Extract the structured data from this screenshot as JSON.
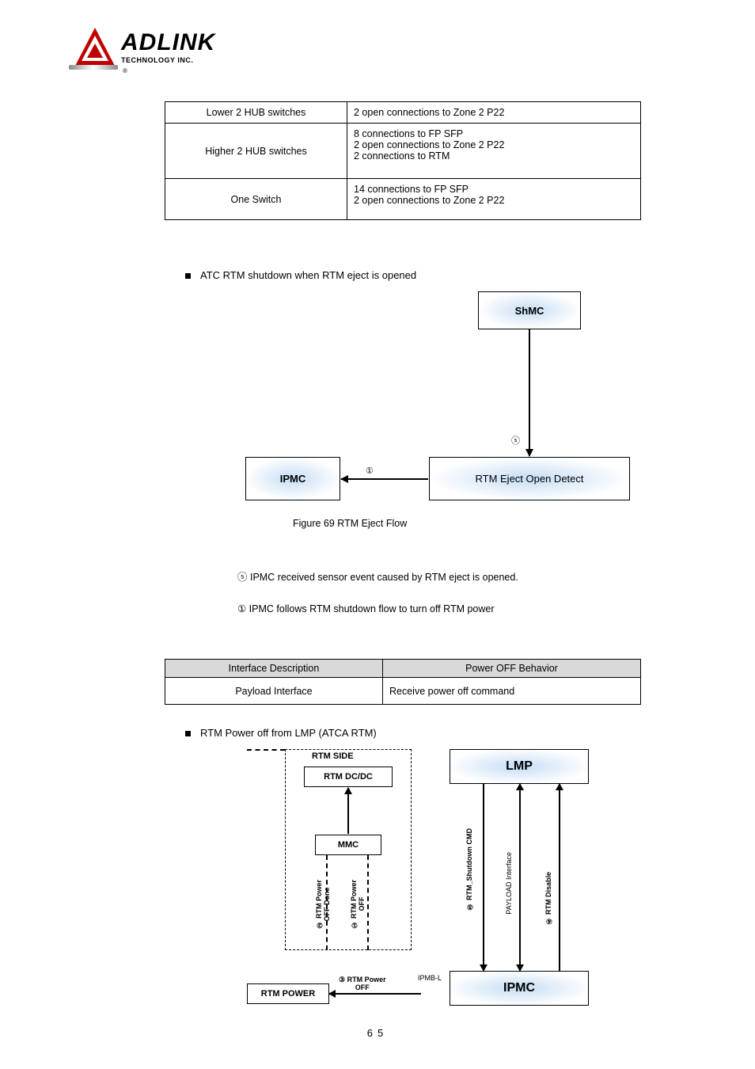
{
  "logo": {
    "name": "ADLINK",
    "sub": "TECHNOLOGY INC."
  },
  "table1": {
    "r1c1": "Lower 2 HUB switches",
    "r1c2": "2 open connections to Zone 2 P22",
    "r2c1": "Higher 2 HUB switches",
    "r2c2": "8 connections to FP SFP\n2 open connections to Zone 2 P22\n2 connections to RTM",
    "r3c1": "One Switch",
    "r3c2": "14 connections to FP SFP\n2 open connections to Zone 2 P22"
  },
  "bullets": {
    "b1": "ATC RTM shutdown when RTM eject is opened",
    "b2": "RTM Power off from LMP (ATCA RTM)"
  },
  "diag1": {
    "shmc": "ShMC",
    "ipmc": "IPMC",
    "eject": "RTM Eject Open Detect",
    "figure": "Figure 69 RTM Eject Flow",
    "marker_s": "ⓢ",
    "marker_1": "①",
    "sub_s": "ⓢ IPMC received sensor event caused by RTM eject is opened.",
    "sub_1": "①  IPMC follows RTM shutdown flow to turn off RTM power"
  },
  "table2": {
    "h1": "Interface Description",
    "h2": "Power OFF Behavior",
    "r1c1": "Payload Interface",
    "r1c2": "Receive power off command"
  },
  "diag2": {
    "rtm_side": "RTM SIDE",
    "rtm_dcdc": "RTM DC/DC",
    "mmc": "MMC",
    "rtm_power": "RTM POWER",
    "lmp": "LMP",
    "ipmc": "IPMC",
    "ipmbl": "IPMB-L",
    "v_off_done": "② RTM Power\nOFF Done",
    "v_off": "① RTM Power\nOFF",
    "v_shutdown": "⑤ RTM_Shutdown CMD",
    "v_payload": "PAYLOAD Interface",
    "v_disable": "④ RTM Disable",
    "h_rtm_off": "③ RTM Power\nOFF"
  },
  "page": "65"
}
